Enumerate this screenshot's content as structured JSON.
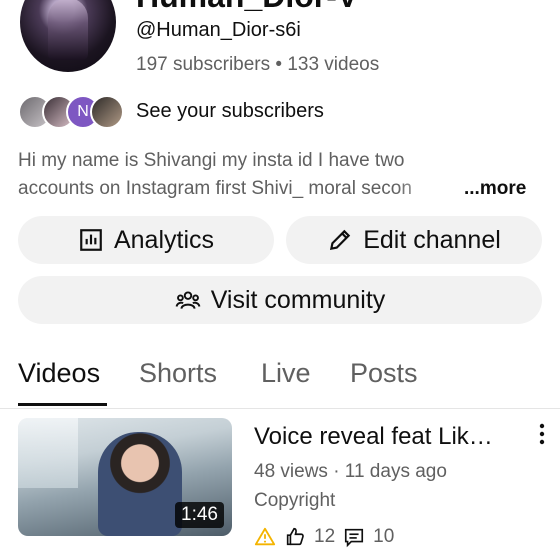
{
  "channel": {
    "name": "Human_Dior-V",
    "handle": "@Human_Dior-s6i",
    "stats": "197 subscribers • 133 videos",
    "see_subscribers": "See your subscribers",
    "subscriber_avatar_letter": "N",
    "description_line1": "Hi my name is Shivangi my insta id I have two",
    "description_line2": "accounts on Instagram first Shivi_ moral secon",
    "more": "...more"
  },
  "buttons": {
    "analytics": "Analytics",
    "edit_channel": "Edit channel",
    "visit_community": "Visit community"
  },
  "tabs": [
    "Videos",
    "Shorts",
    "Live",
    "Posts"
  ],
  "video": {
    "title": "Voice reveal feat Lik…",
    "meta": "48 views · 11 days ago",
    "copyright": "Copyright",
    "duration": "1:46",
    "likes": "12",
    "comments": "10"
  },
  "colors": {
    "accent_warning": "#f4b400",
    "text": "#0f0f0f",
    "secondary": "#606060",
    "pill": "#f2f2f2"
  }
}
